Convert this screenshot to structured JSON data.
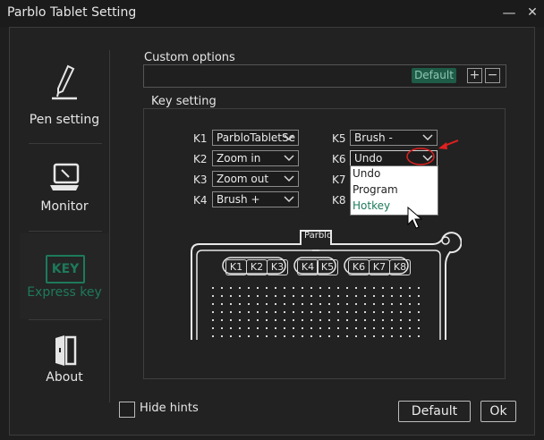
{
  "window": {
    "title": "Parblo Tablet Setting",
    "minimize_glyph": "—",
    "close_glyph": "✕"
  },
  "sidebar": {
    "items": [
      {
        "label": "Pen setting",
        "icon": "pen-icon"
      },
      {
        "label": "Monitor",
        "icon": "monitor-icon"
      },
      {
        "label": "Express key",
        "icon": "key-icon",
        "icon_text": "KEY",
        "active": true
      },
      {
        "label": "About",
        "icon": "about-icon"
      }
    ]
  },
  "custom_options": {
    "label": "Custom options",
    "default_badge": "Default",
    "plus": "+",
    "minus": "−"
  },
  "key_setting": {
    "label": "Key setting",
    "keys": [
      {
        "key": "K1",
        "value": "ParbloTabletSe"
      },
      {
        "key": "K2",
        "value": "Zoom in"
      },
      {
        "key": "K3",
        "value": "Zoom out"
      },
      {
        "key": "K4",
        "value": "Brush +"
      },
      {
        "key": "K5",
        "value": "Brush -"
      },
      {
        "key": "K6",
        "value": "Undo"
      },
      {
        "key": "K7",
        "value": ""
      },
      {
        "key": "K8",
        "value": ""
      }
    ],
    "dropdown_options": [
      "Undo",
      "Program",
      "Hotkey"
    ],
    "dropdown_highlighted": "Hotkey"
  },
  "tablet": {
    "brand": "Parblo",
    "buttons": [
      "K1",
      "K2",
      "K3",
      "K4",
      "K5",
      "K6",
      "K7",
      "K8"
    ]
  },
  "footer": {
    "hide_hints": "Hide hints",
    "default_button": "Default",
    "ok_button": "Ok"
  },
  "colors": {
    "accent": "#1d7a5c",
    "annotation": "#e02020",
    "background": "#222222"
  }
}
